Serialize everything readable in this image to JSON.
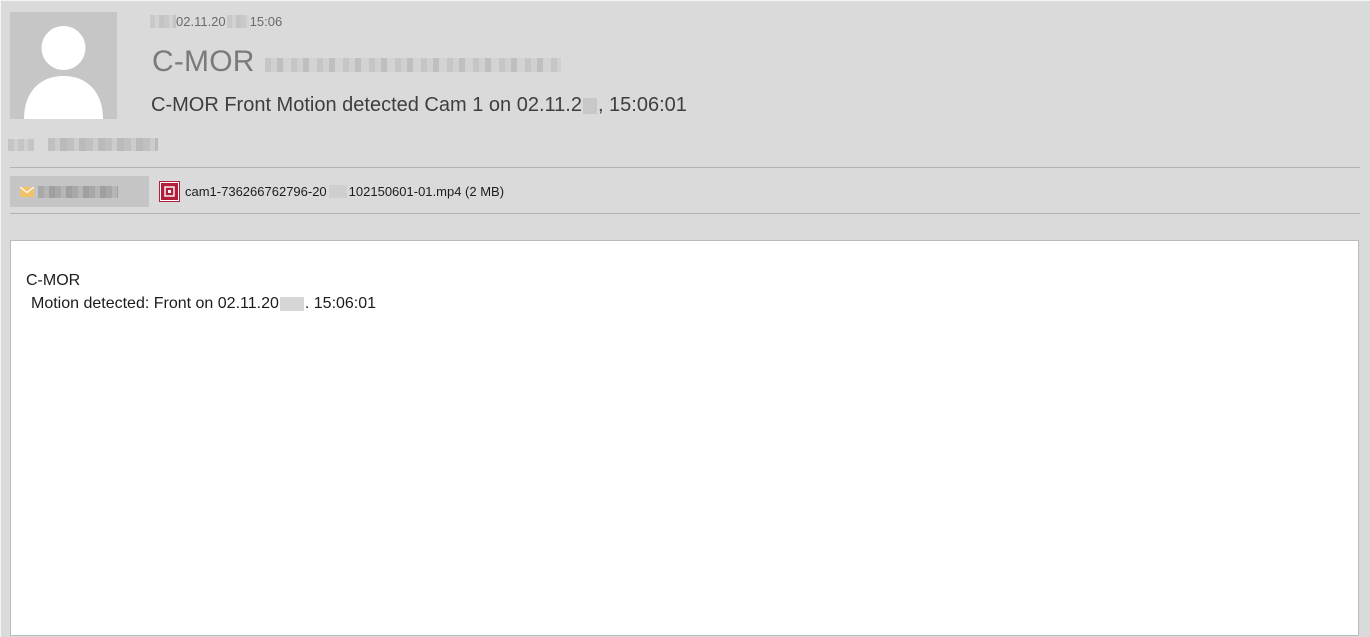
{
  "header": {
    "sent_date_prefix": "02.11.20",
    "sent_time": "15:06",
    "sender_name": "C-MOR",
    "subject_part1": "C-MOR Front Motion detected Cam 1 on 02.11.2",
    "subject_part2": ", 15:06:01"
  },
  "attachments": {
    "file_part1": "cam1-736266762796-20",
    "file_part2": "102150601-01.mp4 (2 MB)"
  },
  "body": {
    "line1": "C-MOR",
    "line2_part1": "Motion detected: Front on 02.11.20",
    "line2_part2": ". 15:06:01"
  },
  "colors": {
    "header_bg": "#dadada",
    "attachment_icon": "#b1203a",
    "envelope_icon": "#f0c36a"
  }
}
